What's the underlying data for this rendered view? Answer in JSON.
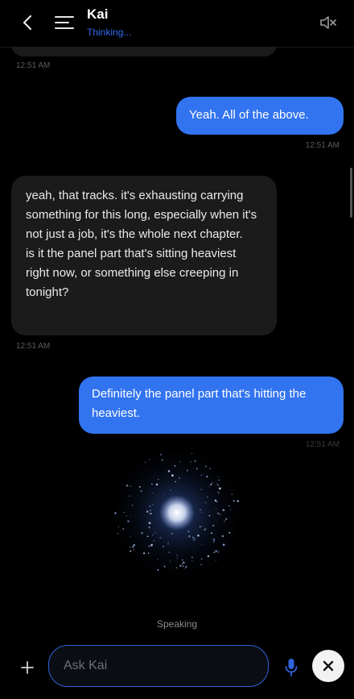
{
  "header": {
    "title": "Kai",
    "status": "Thinking..."
  },
  "messages": [
    {
      "role": "ai",
      "timestamp": "12:51 AM"
    },
    {
      "role": "user",
      "text": "Yeah. All of the above.",
      "timestamp": "12:51 AM"
    },
    {
      "role": "ai",
      "paragraphs": [
        "yeah, that tracks. it's exhausting carrying something for this long, especially when it's not just a job, it's the whole next chapter.",
        "is it the panel part that's sitting heaviest right now, or something else creeping in tonight?"
      ],
      "timestamp": "12:51 AM"
    },
    {
      "role": "user",
      "text": "Definitely the panel part that's hitting the heaviest.",
      "timestamp": "12:51 AM"
    }
  ],
  "voice": {
    "status": "Speaking"
  },
  "composer": {
    "placeholder": "Ask Kai"
  },
  "icons": {
    "back": "chevron-left-icon",
    "menu": "menu-icon",
    "mute": "speaker-muted-icon",
    "plus": "plus-icon",
    "mic": "microphone-icon",
    "close": "close-icon"
  },
  "colors": {
    "background": "#000000",
    "user_bubble": "#3274f0",
    "ai_bubble": "#1b1b1b",
    "accent": "#2f6df0",
    "timestamp": "#5c5c5c"
  }
}
